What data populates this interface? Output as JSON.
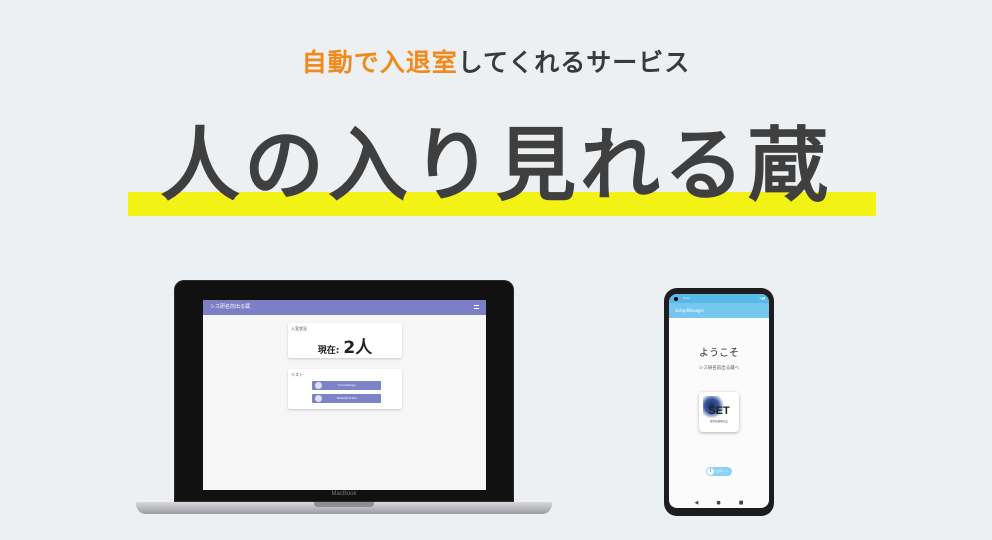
{
  "header": {
    "tagline_highlight": "自動で入退室",
    "tagline_rest": "してくれるサービス",
    "title": "人の入り見れる蔵"
  },
  "laptop": {
    "brand": "MacBook",
    "app_title": "シス研名前出る蔵",
    "count_card_label": "入室状況",
    "count_prefix": "現在:",
    "count_value": "2人",
    "list_card_label": "リスト",
    "users": [
      "Yshumikago",
      "TakeshiHirata"
    ]
  },
  "phone": {
    "time": "9:43",
    "app_title": "SetupManager",
    "welcome": "ようこそ",
    "subtitle": "シス研名前出る蔵へ",
    "logo_text": "SET",
    "logo_subtext": "創作技術研究会",
    "button_label": "ログイン"
  },
  "colors": {
    "accent_orange": "#f08a1c",
    "title_underline": "#f2f215",
    "laptop_appbar": "#7a7fc6",
    "phone_appbar": "#75c7f0"
  }
}
